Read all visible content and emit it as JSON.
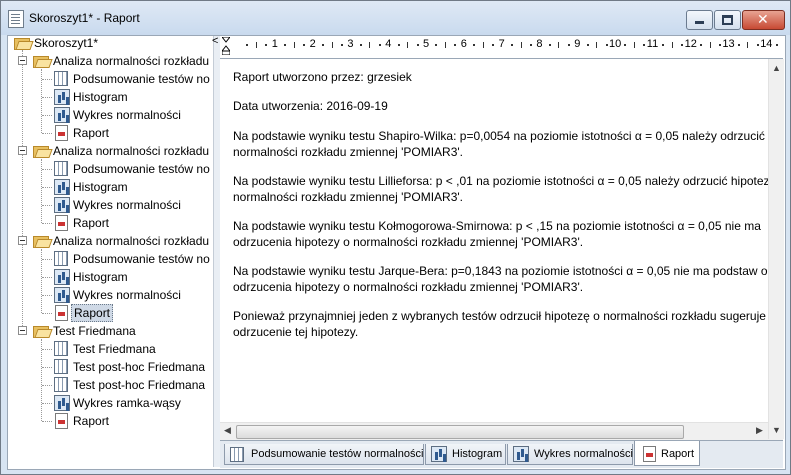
{
  "window": {
    "title": "Skoroszyt1* - Raport",
    "minimize_label": "",
    "maximize_label": "",
    "close_label": "✕"
  },
  "tree": {
    "root": "Skoroszyt1*",
    "groups": [
      {
        "label": "Analiza normalności rozkładu",
        "children": [
          "Podsumowanie testów no",
          "Histogram",
          "Wykres normalności",
          "Raport"
        ]
      },
      {
        "label": "Analiza normalności rozkładu",
        "children": [
          "Podsumowanie testów no",
          "Histogram",
          "Wykres normalności",
          "Raport"
        ]
      },
      {
        "label": "Analiza normalności rozkładu",
        "children": [
          "Podsumowanie testów no",
          "Histogram",
          "Wykres normalności",
          "Raport"
        ]
      },
      {
        "label": "Test Friedmana",
        "children": [
          "Test Friedmana",
          "Test post-hoc Friedmana",
          "Test post-hoc Friedmana",
          "Wykres ramka-wąsy",
          "Raport"
        ]
      }
    ],
    "selected": "Raport (3rd group)"
  },
  "ruler": {
    "numbers": [
      "1",
      "2",
      "3",
      "4",
      "5",
      "6",
      "7",
      "8",
      "9",
      "10",
      "11",
      "12",
      "13",
      "14"
    ]
  },
  "report": {
    "line1": "Raport utworzono przez: grzesiek",
    "line2": "Data utworzenia: 2016-09-19",
    "p1a": "Na podstawie wyniku testu Shapiro-Wilka: p=0,0054 na poziomie istotności α = 0,05 należy odrzucić h",
    "p1b": "normalności rozkładu zmiennej 'POMIAR3'.",
    "p2a": "Na podstawie wyniku testu Lillieforsa: p < ,01 na poziomie istotności α = 0,05 należy odrzucić hipotez",
    "p2b": "normalności rozkładu zmiennej 'POMIAR3'.",
    "p3a": "Na podstawie wyniku testu Kołmogorowa-Smirnowa: p < ,15 na poziomie istotności α = 0,05 nie ma",
    "p3b": "odrzucenia hipotezy o normalności rozkładu zmiennej 'POMIAR3'.",
    "p4a": "Na podstawie wyniku testu Jarque-Bera: p=0,1843 na poziomie istotności α = 0,05 nie ma podstaw o",
    "p4b": "odrzucenia hipotezy o normalności rozkładu zmiennej 'POMIAR3'.",
    "p5a": "Ponieważ przynajmniej jeden z wybranych testów odrzucił hipotezę o normalności rozkładu sugeruje",
    "p5b": "odrzucenie tej hipotezy."
  },
  "tabs": [
    {
      "label": "Podsumowanie testów normalności",
      "icon": "grid-icon"
    },
    {
      "label": "Histogram",
      "icon": "histogram-icon"
    },
    {
      "label": "Wykres normalności",
      "icon": "chart-icon"
    },
    {
      "label": "Raport",
      "icon": "report-icon",
      "active": true
    }
  ],
  "splitter": {
    "arrow": "<"
  }
}
